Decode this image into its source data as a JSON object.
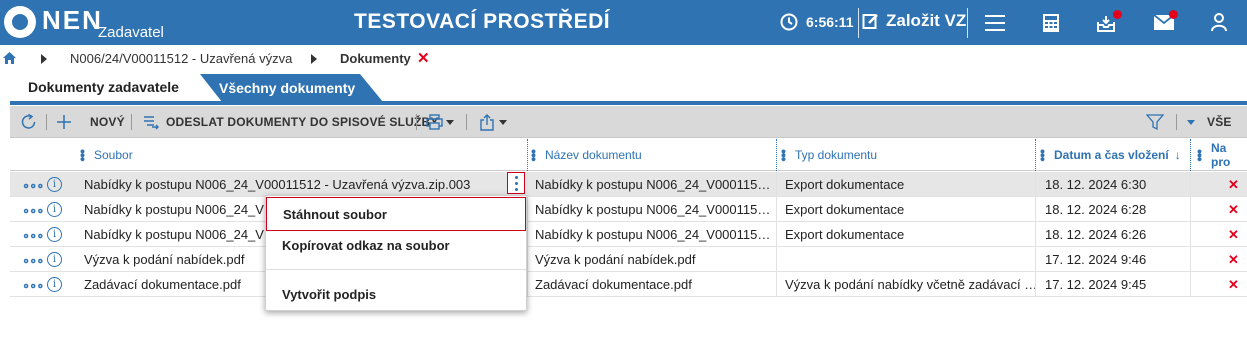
{
  "header": {
    "logo_text": "NEN",
    "logo_sub": "Zadavatel",
    "title": "TESTOVACÍ PROSTŘEDÍ",
    "time": "6:56:11",
    "create_label": "Založit VZ",
    "icons": [
      "clock-icon",
      "edit-icon",
      "menu-icon",
      "calculator-icon",
      "inbox-icon",
      "mail-icon",
      "user-icon"
    ],
    "badge_color": "#e3001b",
    "brand_color": "#2f73b3"
  },
  "breadcrumb": {
    "items": [
      "N006/24/V00011512 - Uzavřená výzva",
      "Dokumenty"
    ],
    "close": "✕"
  },
  "tabs": [
    {
      "label": "Dokumenty zadavatele",
      "active": true
    },
    {
      "label": "Všechny dokumenty",
      "active": false
    }
  ],
  "toolbar": {
    "new_label": "NOVÝ",
    "send_label": "ODESLAT DOKUMENTY DO SPISOVÉ SLUŽBY",
    "filter_value": "VŠE"
  },
  "table": {
    "columns": [
      "Soubor",
      "Název dokumentu",
      "Typ dokumentu",
      "Datum a čas vložení",
      "Na pro"
    ],
    "sort_indicator": "↓",
    "rows": [
      {
        "file": "Nabídky k postupu N006_24_V00011512 - Uzavřená výzva.zip.003",
        "name": "Nabídky k postupu N006_24_V000115…",
        "type": "Export dokumentace",
        "date": "18. 12. 2024 6:30",
        "flag": "✕"
      },
      {
        "file": "Nabídky k postupu N006_24_V000115",
        "name": "Nabídky k postupu N006_24_V000115…",
        "type": "Export dokumentace",
        "date": "18. 12. 2024 6:28",
        "flag": "✕"
      },
      {
        "file": "Nabídky k postupu N006_24_V000115",
        "name": "Nabídky k postupu N006_24_V000115…",
        "type": "Export dokumentace",
        "date": "18. 12. 2024 6:26",
        "flag": "✕"
      },
      {
        "file": "Výzva k podání nabídek.pdf",
        "name": "Výzva k podání nabídek.pdf",
        "type": "",
        "date": "17. 12. 2024 9:46",
        "flag": "✕"
      },
      {
        "file": "Zadávací dokumentace.pdf",
        "name": "Zadávací dokumentace.pdf",
        "type": "Výzva k podání nabídky včetně zadávací …",
        "date": "17. 12. 2024 9:45",
        "flag": "✕"
      }
    ]
  },
  "context_menu": {
    "items": [
      "Stáhnout soubor",
      "Kopírovat odkaz na soubor",
      "Vytvořit podpis"
    ]
  }
}
